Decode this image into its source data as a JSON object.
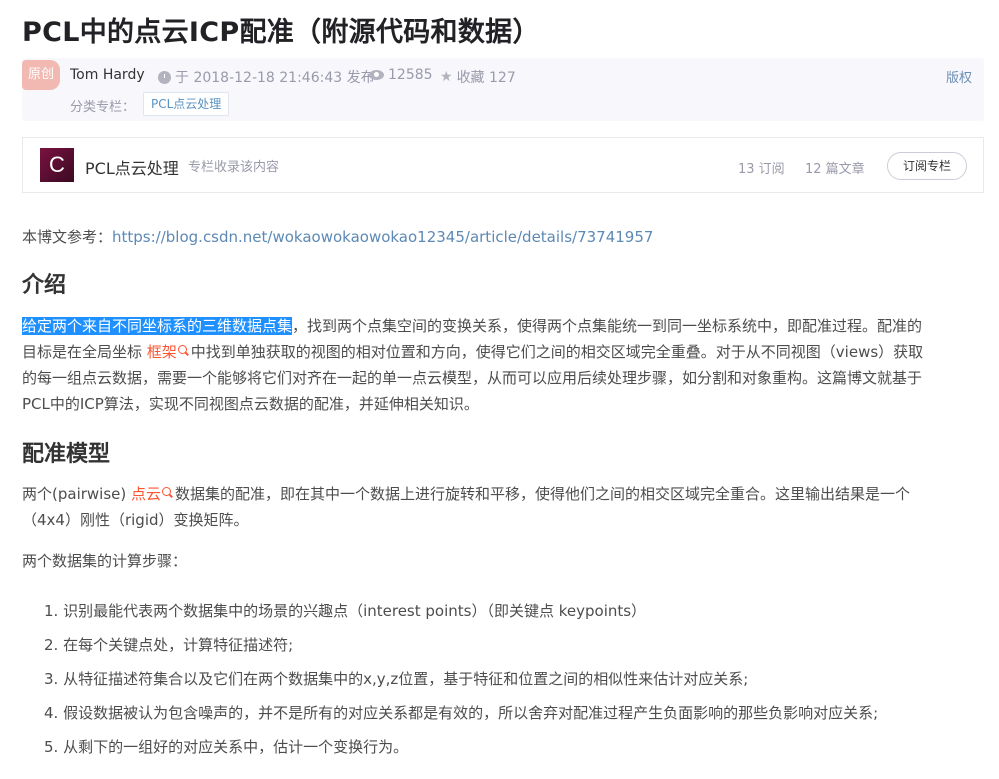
{
  "article": {
    "title": "PCL中的点云ICP配准（附源代码和数据）",
    "badge": "原创",
    "author": "Tom Hardy",
    "published": "于 2018-12-18 21:46:43 发布",
    "views": "12585",
    "favorites": "收藏 127",
    "copyright": "版权",
    "category_label": "分类专栏：",
    "category_tag": "PCL点云处理"
  },
  "column": {
    "avatar_letter": "C",
    "title": "PCL点云处理",
    "subtitle": "专栏收录该内容",
    "subscriptions": "13 订阅",
    "articles": "12 篇文章",
    "subscribe_label": "订阅专栏"
  },
  "content": {
    "ref_prefix": "本博文参考：",
    "ref_url": "https://blog.csdn.net/wokaowokaowokao12345/article/details/73741957",
    "h_intro": "介绍",
    "intro_highlight": "给定两个来自不同坐标系的三维数据点集",
    "intro_p1": "，找到两个点集空间的变换关系，使得两个点集能统一到同一坐标系统中，即配准过程。配准的",
    "intro_p2_a": "目标是在全局坐标 ",
    "intro_kw": "框架",
    "intro_p2_b": "中找到单独获取的视图的相对位置和方向，使得它们之间的相交区域完全重叠。对于从不同视图（views）获取",
    "intro_p3": "的每一组点云数据，需要一个能够将它们对齐在一起的单一点云模型，从而可以应用后续处理步骤，如分割和对象重构。这篇博文就基于",
    "intro_p4": "PCL中的ICP算法，实现不同视图点云数据的配准，并延伸相关知识。",
    "h_model": "配准模型",
    "model_a": "两个(pairwise) ",
    "model_kw": "点云",
    "model_b": "数据集的配准，即在其中一个数据上进行旋转和平移，使得他们之间的相交区域完全重合。这里输出结果是一个",
    "model_c": "（4x4）刚性（rigid）变换矩阵。",
    "steps_intro": "两个数据集的计算步骤：",
    "steps": [
      "1. 识别最能代表两个数据集中的场景的兴趣点（interest points）（即关键点 keypoints）",
      "2. 在每个关键点处，计算特征描述符;",
      "3. 从特征描述符集合以及它们在两个数据集中的x,y,z位置，基于特征和位置之间的相似性来估计对应关系;",
      "4. 假设数据被认为包含噪声的，并不是所有的对应关系都是有效的，所以舍弃对配准过程产生负面影响的那些负影响对应关系;",
      "5. 从剩下的一组好的对应关系中，估计一个变换行为。"
    ]
  }
}
